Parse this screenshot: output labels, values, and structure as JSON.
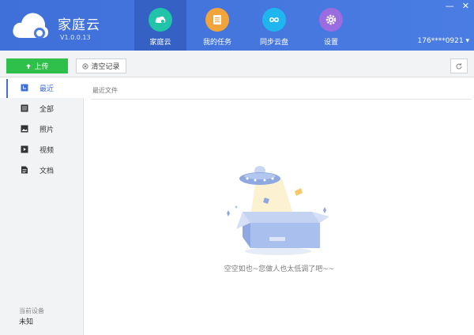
{
  "app": {
    "title": "家庭云",
    "version": "V1.0.0.13",
    "colors": {
      "header": "#3f6fd9",
      "accent": "#3f6fd9",
      "upload": "#2ec04a"
    }
  },
  "nav": [
    {
      "label": "家庭云",
      "icon": "cloud-icon",
      "color": "#21c4a8",
      "active": true
    },
    {
      "label": "我的任务",
      "icon": "task-list-icon",
      "color": "#f0a43a",
      "active": false
    },
    {
      "label": "同步云盘",
      "icon": "sync-icon",
      "color": "#1fb6ef",
      "active": false
    },
    {
      "label": "设置",
      "icon": "gear-icon",
      "color": "#9b6be0",
      "active": false
    }
  ],
  "window": {
    "minimize": "—",
    "close": "✕"
  },
  "user": {
    "account": "176****0921 ▾"
  },
  "toolbar": {
    "upload_label": "上传",
    "clear_label": "清空记录"
  },
  "sidebar": {
    "items": [
      {
        "label": "最近",
        "icon": "clock-icon",
        "active": true
      },
      {
        "label": "全部",
        "icon": "list-icon",
        "active": false
      },
      {
        "label": "照片",
        "icon": "photo-icon",
        "active": false
      },
      {
        "label": "视频",
        "icon": "video-icon",
        "active": false
      },
      {
        "label": "文档",
        "icon": "document-icon",
        "active": false
      }
    ],
    "device_label": "当前设备",
    "device_value": "未知"
  },
  "main": {
    "section_title": "最近文件",
    "empty_text": "空空如也~您做人也太低调了吧~~"
  }
}
